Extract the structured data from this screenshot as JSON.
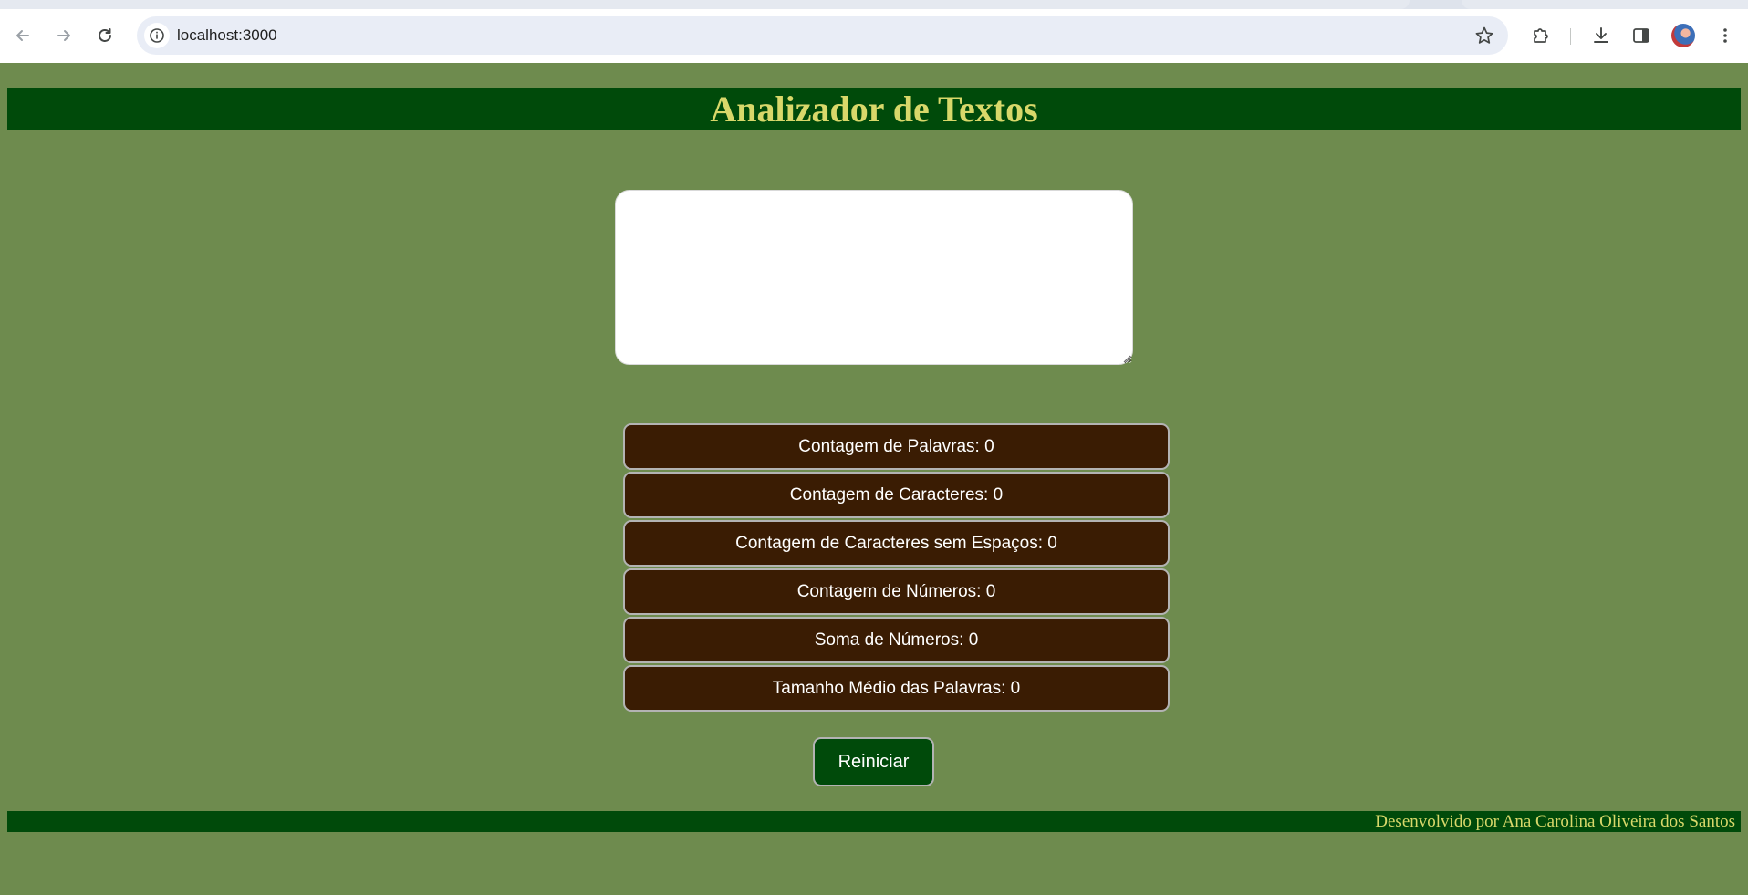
{
  "browser": {
    "url": "localhost:3000",
    "icons": {
      "back": "arrow-left-icon",
      "forward": "arrow-right-icon",
      "reload": "reload-icon",
      "site_info": "info-icon",
      "bookmark": "star-icon",
      "extensions": "puzzle-icon",
      "downloads": "download-icon",
      "side_panel": "side-panel-icon",
      "menu": "kebab-menu-icon"
    }
  },
  "page": {
    "title": "Analizador de Textos",
    "textarea": {
      "value": "",
      "placeholder": ""
    },
    "stats": [
      {
        "label": "Contagem de Palavras:",
        "value": "0"
      },
      {
        "label": "Contagem de Caracteres:",
        "value": "0"
      },
      {
        "label": "Contagem de Caracteres sem Espaços:",
        "value": "0"
      },
      {
        "label": "Contagem de Números:",
        "value": "0"
      },
      {
        "label": "Soma de Números:",
        "value": "0"
      },
      {
        "label": "Tamanho Médio das Palavras:",
        "value": "0"
      }
    ],
    "reset_label": "Reiniciar",
    "footer": "Desenvolvido por Ana Carolina Oliveira dos Santos"
  },
  "colors": {
    "page_background": "#6e8b4e",
    "header_background": "#004a0a",
    "title_text": "#d8d86a",
    "stat_background": "#3a1c03",
    "stat_border": "#b3b3b3",
    "button_background": "#004a0a"
  }
}
